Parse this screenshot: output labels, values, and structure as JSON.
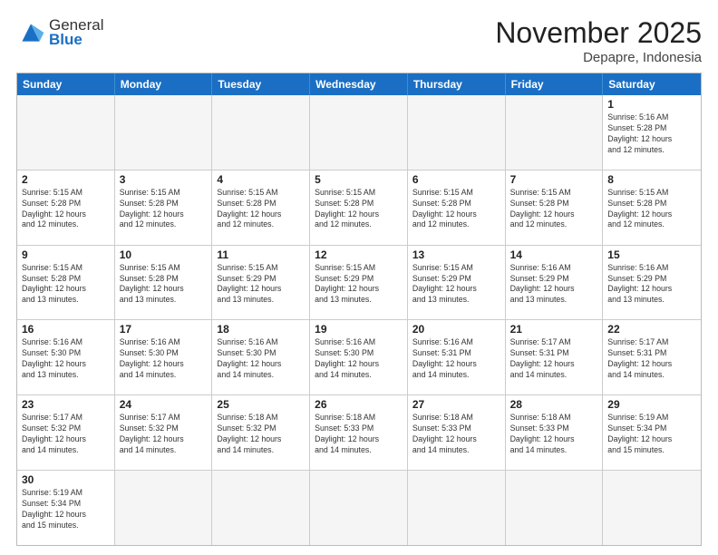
{
  "header": {
    "logo_general": "General",
    "logo_blue": "Blue",
    "month_title": "November 2025",
    "location": "Depapre, Indonesia"
  },
  "days_of_week": [
    "Sunday",
    "Monday",
    "Tuesday",
    "Wednesday",
    "Thursday",
    "Friday",
    "Saturday"
  ],
  "weeks": [
    [
      {
        "day": "",
        "empty": true
      },
      {
        "day": "",
        "empty": true
      },
      {
        "day": "",
        "empty": true
      },
      {
        "day": "",
        "empty": true
      },
      {
        "day": "",
        "empty": true
      },
      {
        "day": "",
        "empty": true
      },
      {
        "day": "1",
        "sunrise": "5:16 AM",
        "sunset": "5:28 PM",
        "hours": "12 hours",
        "minutes": "12 minutes."
      }
    ],
    [
      {
        "day": "2",
        "sunrise": "5:15 AM",
        "sunset": "5:28 PM",
        "hours": "12 hours",
        "minutes": "12 minutes."
      },
      {
        "day": "3",
        "sunrise": "5:15 AM",
        "sunset": "5:28 PM",
        "hours": "12 hours",
        "minutes": "12 minutes."
      },
      {
        "day": "4",
        "sunrise": "5:15 AM",
        "sunset": "5:28 PM",
        "hours": "12 hours",
        "minutes": "12 minutes."
      },
      {
        "day": "5",
        "sunrise": "5:15 AM",
        "sunset": "5:28 PM",
        "hours": "12 hours",
        "minutes": "12 minutes."
      },
      {
        "day": "6",
        "sunrise": "5:15 AM",
        "sunset": "5:28 PM",
        "hours": "12 hours",
        "minutes": "12 minutes."
      },
      {
        "day": "7",
        "sunrise": "5:15 AM",
        "sunset": "5:28 PM",
        "hours": "12 hours",
        "minutes": "12 minutes."
      },
      {
        "day": "8",
        "sunrise": "5:15 AM",
        "sunset": "5:28 PM",
        "hours": "12 hours",
        "minutes": "12 minutes."
      }
    ],
    [
      {
        "day": "9",
        "sunrise": "5:15 AM",
        "sunset": "5:28 PM",
        "hours": "12 hours",
        "minutes": "13 minutes."
      },
      {
        "day": "10",
        "sunrise": "5:15 AM",
        "sunset": "5:28 PM",
        "hours": "12 hours",
        "minutes": "13 minutes."
      },
      {
        "day": "11",
        "sunrise": "5:15 AM",
        "sunset": "5:29 PM",
        "hours": "12 hours",
        "minutes": "13 minutes."
      },
      {
        "day": "12",
        "sunrise": "5:15 AM",
        "sunset": "5:29 PM",
        "hours": "12 hours",
        "minutes": "13 minutes."
      },
      {
        "day": "13",
        "sunrise": "5:15 AM",
        "sunset": "5:29 PM",
        "hours": "12 hours",
        "minutes": "13 minutes."
      },
      {
        "day": "14",
        "sunrise": "5:16 AM",
        "sunset": "5:29 PM",
        "hours": "12 hours",
        "minutes": "13 minutes."
      },
      {
        "day": "15",
        "sunrise": "5:16 AM",
        "sunset": "5:29 PM",
        "hours": "12 hours",
        "minutes": "13 minutes."
      }
    ],
    [
      {
        "day": "16",
        "sunrise": "5:16 AM",
        "sunset": "5:30 PM",
        "hours": "12 hours",
        "minutes": "13 minutes."
      },
      {
        "day": "17",
        "sunrise": "5:16 AM",
        "sunset": "5:30 PM",
        "hours": "12 hours",
        "minutes": "14 minutes."
      },
      {
        "day": "18",
        "sunrise": "5:16 AM",
        "sunset": "5:30 PM",
        "hours": "12 hours",
        "minutes": "14 minutes."
      },
      {
        "day": "19",
        "sunrise": "5:16 AM",
        "sunset": "5:30 PM",
        "hours": "12 hours",
        "minutes": "14 minutes."
      },
      {
        "day": "20",
        "sunrise": "5:16 AM",
        "sunset": "5:31 PM",
        "hours": "12 hours",
        "minutes": "14 minutes."
      },
      {
        "day": "21",
        "sunrise": "5:17 AM",
        "sunset": "5:31 PM",
        "hours": "12 hours",
        "minutes": "14 minutes."
      },
      {
        "day": "22",
        "sunrise": "5:17 AM",
        "sunset": "5:31 PM",
        "hours": "12 hours",
        "minutes": "14 minutes."
      }
    ],
    [
      {
        "day": "23",
        "sunrise": "5:17 AM",
        "sunset": "5:32 PM",
        "hours": "12 hours",
        "minutes": "14 minutes."
      },
      {
        "day": "24",
        "sunrise": "5:17 AM",
        "sunset": "5:32 PM",
        "hours": "12 hours",
        "minutes": "14 minutes."
      },
      {
        "day": "25",
        "sunrise": "5:18 AM",
        "sunset": "5:32 PM",
        "hours": "12 hours",
        "minutes": "14 minutes."
      },
      {
        "day": "26",
        "sunrise": "5:18 AM",
        "sunset": "5:33 PM",
        "hours": "12 hours",
        "minutes": "14 minutes."
      },
      {
        "day": "27",
        "sunrise": "5:18 AM",
        "sunset": "5:33 PM",
        "hours": "12 hours",
        "minutes": "14 minutes."
      },
      {
        "day": "28",
        "sunrise": "5:18 AM",
        "sunset": "5:33 PM",
        "hours": "12 hours",
        "minutes": "14 minutes."
      },
      {
        "day": "29",
        "sunrise": "5:19 AM",
        "sunset": "5:34 PM",
        "hours": "12 hours",
        "minutes": "15 minutes."
      }
    ],
    [
      {
        "day": "30",
        "sunrise": "5:19 AM",
        "sunset": "5:34 PM",
        "hours": "12 hours",
        "minutes": "15 minutes."
      },
      {
        "day": "",
        "empty": true
      },
      {
        "day": "",
        "empty": true
      },
      {
        "day": "",
        "empty": true
      },
      {
        "day": "",
        "empty": true
      },
      {
        "day": "",
        "empty": true
      },
      {
        "day": "",
        "empty": true
      }
    ]
  ],
  "labels": {
    "sunrise": "Sunrise:",
    "sunset": "Sunset:",
    "daylight": "Daylight:"
  }
}
